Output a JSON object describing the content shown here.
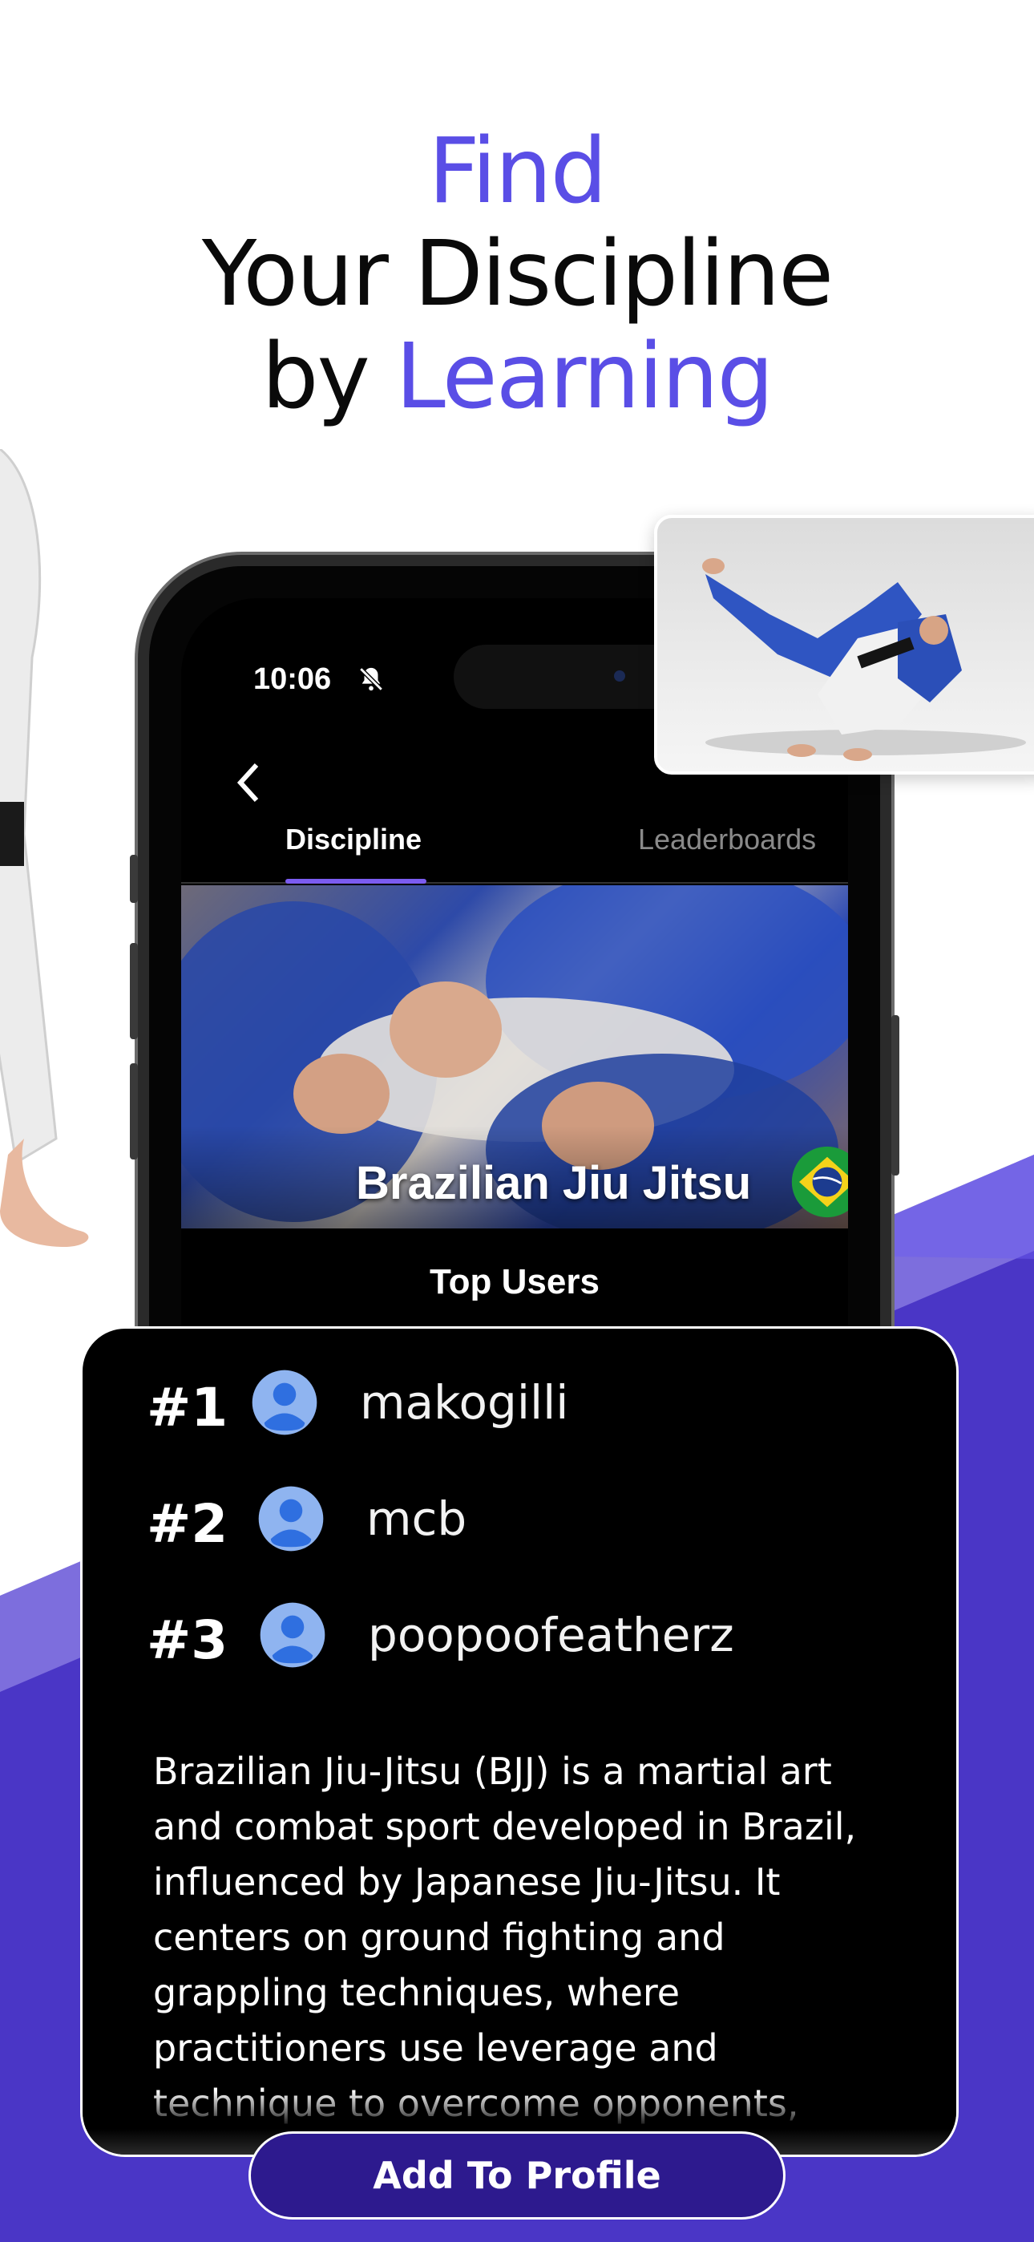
{
  "headline": {
    "line1": "Find",
    "line2": "Your Discipline",
    "line3_prefix": "by ",
    "line3_accent": "Learning"
  },
  "status_bar": {
    "time": "10:06",
    "bell_icon": "bell-slash-icon"
  },
  "tabs": [
    {
      "label": "Discipline",
      "active": true
    },
    {
      "label": "Leaderboards",
      "active": false
    }
  ],
  "discipline": {
    "name": "Brazilian Jiu Jitsu",
    "flag_icon": "brazil-flag-icon"
  },
  "top_users_heading": "Top Users",
  "leaderboard": [
    {
      "rank": "#1",
      "username": "makogilli"
    },
    {
      "rank": "#2",
      "username": "mcb"
    },
    {
      "rank": "#3",
      "username": "poopoofeatherz"
    }
  ],
  "description": "Brazilian Jiu-Jitsu (BJJ) is a martial art and combat sport developed in Brazil, influenced by Japanese Jiu-Jitsu. It centers on ground fighting and grappling techniques, where practitioners use leverage and technique to overcome opponents,",
  "add_button_label": "Add To Profile",
  "colors": {
    "accent": "#5a4ee6",
    "purple_bg": "#4a35c4",
    "button": "#2d1a8e"
  }
}
